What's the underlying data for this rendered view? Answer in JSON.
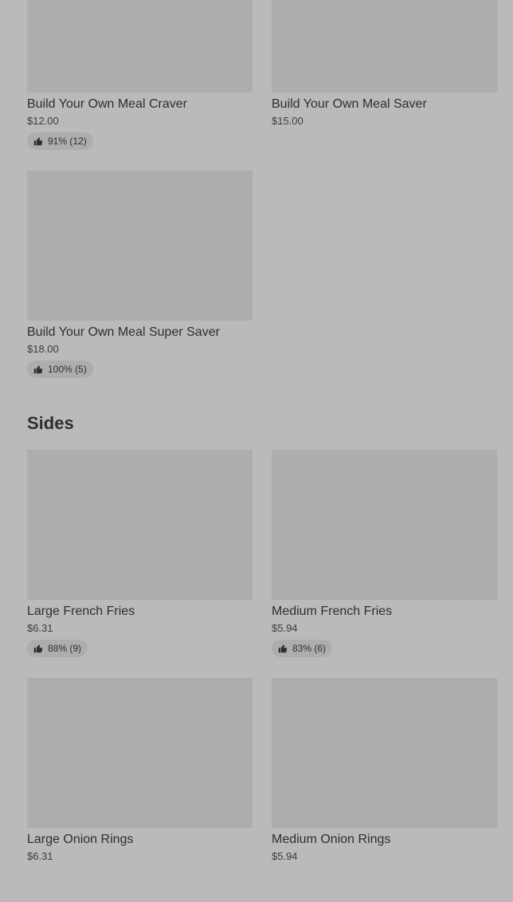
{
  "meals": {
    "items": [
      {
        "name": "Build Your Own Meal Craver",
        "price": "$12.00",
        "rating": "91% (12)"
      },
      {
        "name": "Build Your Own Meal Saver",
        "price": "$15.00"
      },
      {
        "name": "Build Your Own Meal Super Saver",
        "price": "$18.00",
        "rating": "100% (5)"
      }
    ]
  },
  "sides": {
    "title": "Sides",
    "items": [
      {
        "name": "Large French Fries",
        "price": "$6.31",
        "rating": "88% (9)"
      },
      {
        "name": "Medium French Fries",
        "price": "$5.94",
        "rating": "83% (6)"
      },
      {
        "name": "Large Onion Rings",
        "price": "$6.31"
      },
      {
        "name": "Medium Onion Rings",
        "price": "$5.94"
      }
    ]
  },
  "icons": {
    "rating": "thumbs-up-icon"
  },
  "colors": {
    "background": "#bababa",
    "image_placeholder": "#adadad",
    "text": "#2e2e2e"
  }
}
